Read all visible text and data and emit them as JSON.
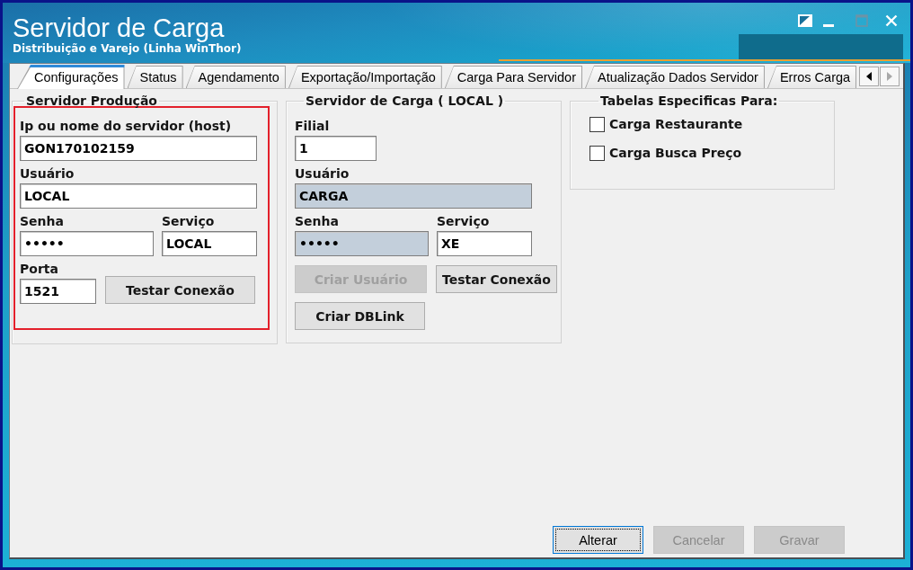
{
  "window": {
    "title": "Servidor de Carga",
    "subtitle": "Distribuição e Varejo (Linha WinThor)",
    "maximize_disabled": true
  },
  "tabs": [
    {
      "label": "Configurações",
      "selected": true
    },
    {
      "label": "Status",
      "selected": false
    },
    {
      "label": "Agendamento",
      "selected": false
    },
    {
      "label": "Exportação/Importação",
      "selected": false
    },
    {
      "label": "Carga Para Servidor",
      "selected": false
    },
    {
      "label": "Atualização Dados Servidor",
      "selected": false
    },
    {
      "label": "Erros Carga",
      "selected": false
    }
  ],
  "tab_scroll": {
    "back_disabled": false,
    "forward_disabled": true
  },
  "groups": [
    {
      "kind": "form",
      "title": "Servidor Produção",
      "highlighted": true,
      "rows": [
        [
          {
            "kind": "field",
            "label": "Ip ou nome do servidor (host)",
            "value": "GON170102159",
            "disabled": false
          }
        ],
        [
          {
            "kind": "field",
            "label": "Usuário",
            "value": "LOCAL",
            "disabled": false
          }
        ],
        [
          {
            "kind": "field",
            "label": "Senha",
            "value": "•••••",
            "disabled": false
          },
          {
            "kind": "field",
            "label": "Serviço",
            "value": "LOCAL",
            "disabled": false
          }
        ],
        [
          {
            "kind": "field",
            "label": "Porta",
            "value": "1521",
            "disabled": false
          },
          {
            "kind": "button",
            "label": "Testar Conexão",
            "disabled": false
          }
        ]
      ]
    },
    {
      "kind": "form",
      "title": "Servidor de Carga ( LOCAL )",
      "highlighted": false,
      "rows": [
        [
          {
            "kind": "field",
            "label": "Filial",
            "value": "1",
            "disabled": false
          }
        ],
        [
          {
            "kind": "field",
            "label": "Usuário",
            "value": "CARGA",
            "disabled": true
          }
        ],
        [
          {
            "kind": "field",
            "label": "Senha",
            "value": "•••••",
            "disabled": true
          },
          {
            "kind": "field",
            "label": "Serviço",
            "value": "XE",
            "disabled": false
          }
        ],
        [
          {
            "kind": "button",
            "label": "Criar Usuário",
            "disabled": true
          },
          {
            "kind": "button",
            "label": "Testar Conexão",
            "disabled": false
          }
        ],
        [
          {
            "kind": "button",
            "label": "Criar DBLink",
            "disabled": false
          }
        ]
      ]
    },
    {
      "kind": "checklist",
      "title": "Tabelas Especificas Para:",
      "highlighted": false,
      "options": [
        {
          "label": "Carga Restaurante",
          "checked": false
        },
        {
          "label": "Carga Busca Preço",
          "checked": false
        }
      ]
    }
  ],
  "actions": [
    {
      "label": "Alterar",
      "disabled": false,
      "focused": true
    },
    {
      "label": "Cancelar",
      "disabled": true,
      "focused": false
    },
    {
      "label": "Gravar",
      "disabled": true,
      "focused": false
    }
  ]
}
